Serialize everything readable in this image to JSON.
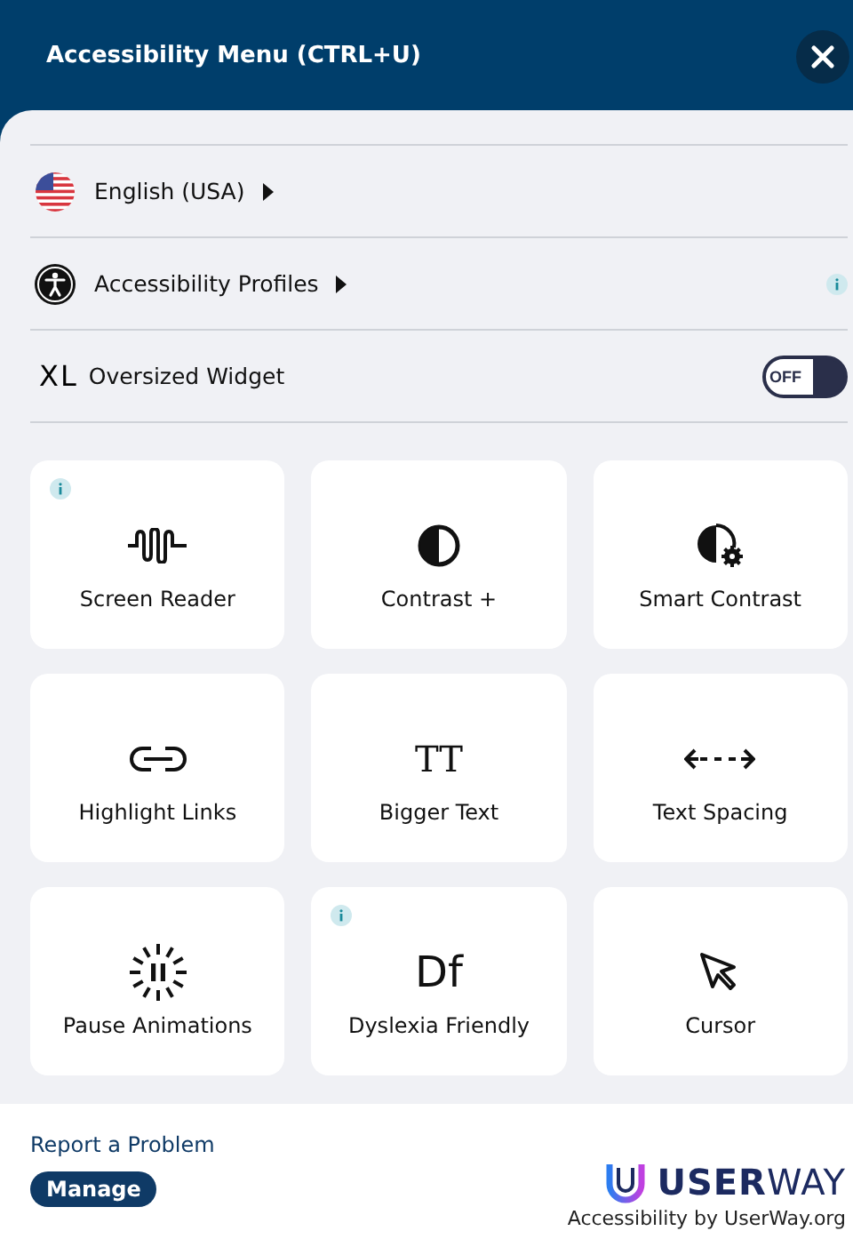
{
  "header": {
    "title": "Accessibility Menu (CTRL+U)"
  },
  "rows": [
    {
      "kind": "language",
      "label": "English (USA)",
      "arrow": true
    },
    {
      "kind": "profiles",
      "label": "Accessibility Profiles",
      "arrow": true,
      "info": true
    },
    {
      "kind": "toggle",
      "glyph": "XL",
      "label": "Oversized Widget",
      "on": false,
      "toggle_text": "OFF"
    }
  ],
  "tiles": [
    {
      "kind": "wave",
      "label": "Screen Reader",
      "info": true
    },
    {
      "kind": "contrast",
      "label": "Contrast +",
      "info": false
    },
    {
      "kind": "smart",
      "label": "Smart Contrast",
      "info": false
    },
    {
      "kind": "link",
      "label": "Highlight Links",
      "info": false
    },
    {
      "kind": "glyph",
      "glyph": "TT",
      "label": "Bigger Text",
      "info": false
    },
    {
      "kind": "spacing",
      "label": "Text Spacing",
      "info": false
    },
    {
      "kind": "pause",
      "label": "Pause Animations",
      "info": false
    },
    {
      "kind": "glyph",
      "glyph": "Df",
      "label": "Dyslexia Friendly",
      "info": true
    },
    {
      "kind": "cursor",
      "label": "Cursor",
      "info": false
    }
  ],
  "footer": {
    "report": "Report a Problem",
    "manage": "Manage",
    "logo": "**USER**WAY",
    "tagline": "Accessibility by UserWay.org"
  }
}
